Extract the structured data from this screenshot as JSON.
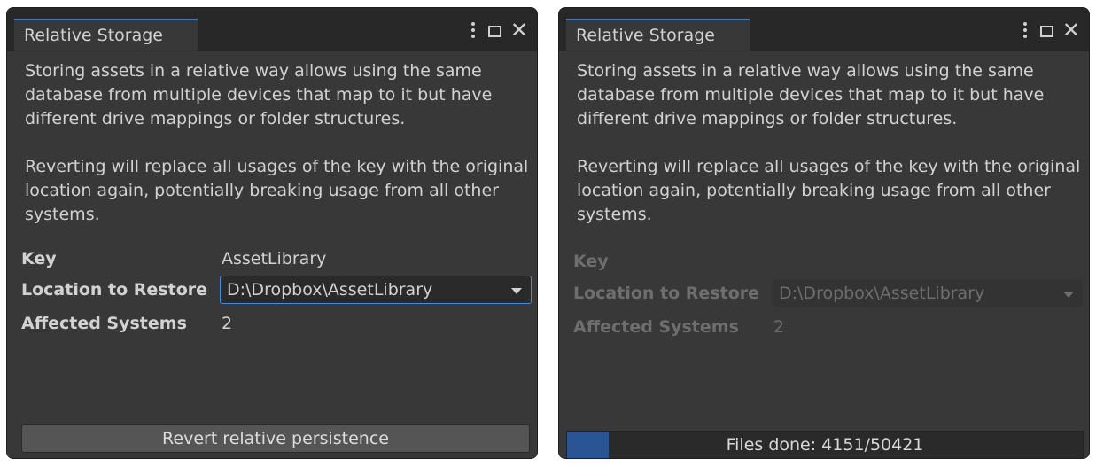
{
  "left_panel": {
    "tab_title": "Relative Storage",
    "description_1": "Storing assets in a relative way allows using the same database from multiple devices that map to it but have different drive mappings or folder structures.",
    "description_2": "Reverting will replace all usages of the key with the original location again, potentially breaking usage from all other systems.",
    "key_label": "Key",
    "key_value": "AssetLibrary",
    "location_label": "Location to Restore",
    "location_value": "D:\\Dropbox\\AssetLibrary",
    "affected_label": "Affected Systems",
    "affected_value": "2",
    "revert_button": "Revert relative persistence"
  },
  "right_panel": {
    "tab_title": "Relative Storage",
    "description_1": "Storing assets in a relative way allows using the same database from multiple devices that map to it but have different drive mappings or folder structures.",
    "description_2": "Reverting will replace all usages of the key with the original location again, potentially breaking usage from all other systems.",
    "key_label": "Key",
    "location_label": "Location to Restore",
    "location_value": "D:\\Dropbox\\AssetLibrary",
    "affected_label": "Affected Systems",
    "affected_value": "2",
    "progress_text": "Files done: 4151/50421",
    "progress_fraction": 0.08
  },
  "icons": {
    "menu": "kebab-menu-icon",
    "maximize": "maximize-icon",
    "close": "close-icon",
    "dropdown": "chevron-down-icon"
  },
  "colors": {
    "accent": "#3a79bb",
    "progress_fill": "#2a5595",
    "panel_bg": "#383838"
  }
}
